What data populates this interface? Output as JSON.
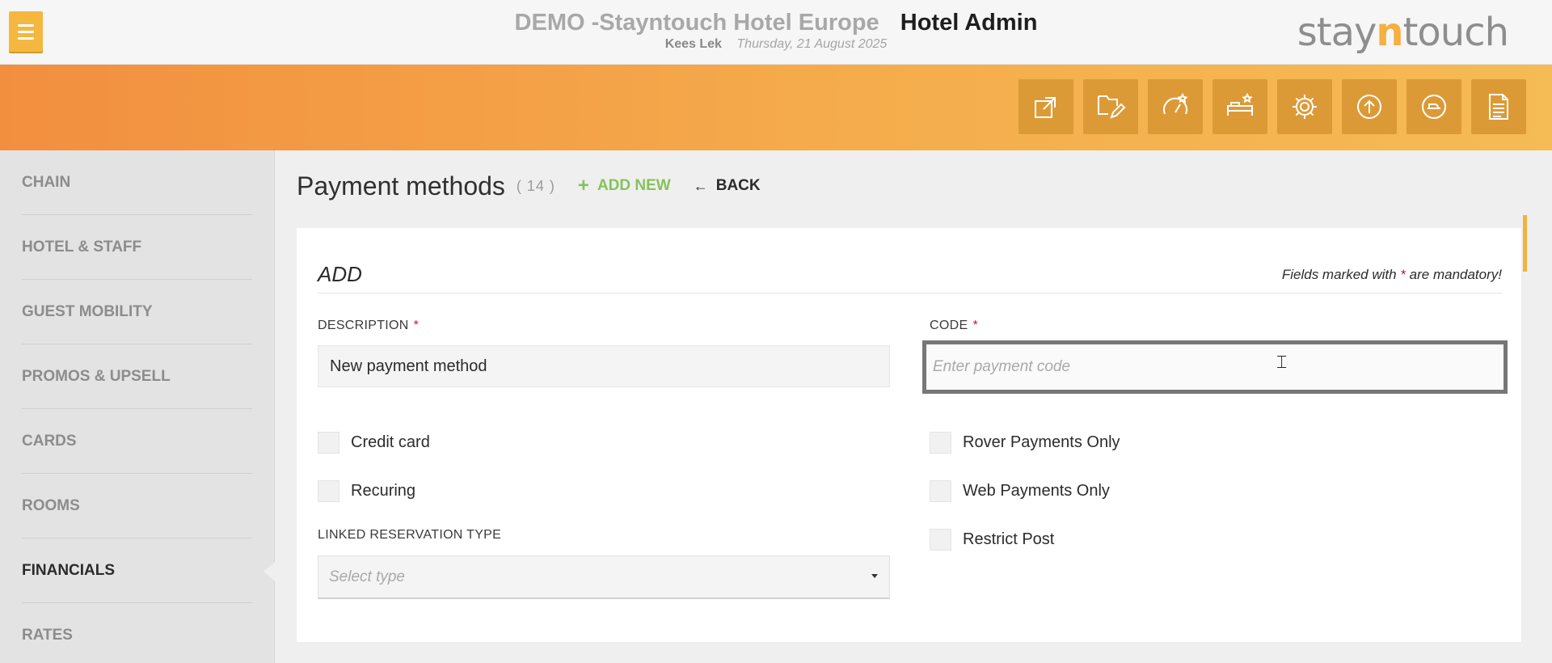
{
  "header": {
    "hotel_name": "DEMO -Stayntouch Hotel Europe",
    "admin_title": "Hotel Admin",
    "user": "Kees Lek",
    "date": "Thursday, 21 August 2025",
    "brand": {
      "pre": "stay",
      "accent": "n",
      "post": "touch"
    }
  },
  "toolbar_icons": [
    "external-link-icon",
    "edit-folder-icon",
    "dashboard-star-icon",
    "bed-star-icon",
    "gear-icon",
    "upload-icon",
    "checkout-icon",
    "document-icon"
  ],
  "sidebar": {
    "items": [
      {
        "label": "CHAIN"
      },
      {
        "label": "HOTEL & STAFF"
      },
      {
        "label": "GUEST MOBILITY"
      },
      {
        "label": "PROMOS & UPSELL"
      },
      {
        "label": "CARDS"
      },
      {
        "label": "ROOMS"
      },
      {
        "label": "FINANCIALS",
        "active": true
      },
      {
        "label": "RATES"
      }
    ]
  },
  "page": {
    "title": "Payment methods",
    "count": "( 14 )",
    "add_new": "ADD NEW",
    "back": "BACK"
  },
  "form": {
    "heading": "ADD",
    "mandatory_pre": "Fields marked with",
    "mandatory_star": "*",
    "mandatory_post": "are mandatory!",
    "description_label": "DESCRIPTION",
    "description_value": "New payment method",
    "code_label": "CODE",
    "code_placeholder": "Enter payment code",
    "required_star": "*",
    "checkboxes": {
      "credit_card": "Credit card",
      "recuring": "Recuring",
      "rover_only": "Rover Payments Only",
      "web_only": "Web Payments Only",
      "restrict_post": "Restrict Post"
    },
    "linked_label": "LINKED RESERVATION TYPE",
    "linked_placeholder": "Select type"
  },
  "colors": {
    "accent": "#f5b73f",
    "band_start": "#f28f3f",
    "band_end": "#f5bb55",
    "add_green": "#86c25a",
    "required_red": "#d0103a"
  }
}
